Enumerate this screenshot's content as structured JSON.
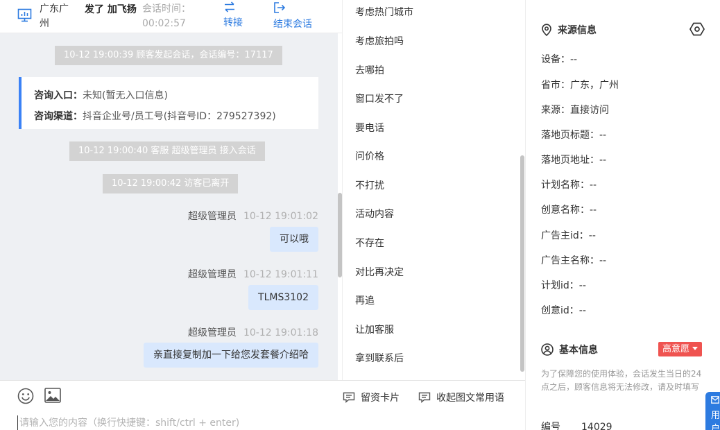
{
  "header": {
    "location": "广东广州",
    "visitor_name": "发了 加飞扬",
    "session_time_label": "会话时间：",
    "session_time_value": "00:02:57",
    "transfer_label": "转接",
    "end_label": "结束会话"
  },
  "chat": {
    "system_start": "10-12 19:00:39 顾客发起会话，会话编号：17117",
    "entry_label": "咨询入口：",
    "entry_value": "未知(暂无入口信息)",
    "channel_label": "咨询渠道：",
    "channel_value": "抖音企业号/员工号(抖音号ID：279527392)",
    "system_join": "10-12 19:00:40 客服 超级管理员 接入会话",
    "system_left": "10-12 19:00:42 访客已离开",
    "messages": [
      {
        "sender": "超级管理员",
        "time": "10-12 19:01:02",
        "text": "可以哦"
      },
      {
        "sender": "超级管理员",
        "time": "10-12 19:01:11",
        "text": "TLMS3102"
      },
      {
        "sender": "超级管理员",
        "time": "10-12 19:01:18",
        "text": "亲直接复制加一下给您发套餐介绍哈"
      }
    ]
  },
  "composer": {
    "card_label": "留资卡片",
    "collapse_label": "收起图文常用语",
    "placeholder": "请输入您的内容（换行快捷键：shift/ctrl + enter)"
  },
  "quick_replies": [
    "考虑热门城市",
    "考虑旅拍吗",
    "去哪拍",
    "窗口发不了",
    "要电话",
    "问价格",
    "不打扰",
    "活动内容",
    "不存在",
    "对比再决定",
    "再追",
    "让加客服",
    "拿到联系后"
  ],
  "source": {
    "title": "来源信息",
    "rows": [
      {
        "label": "设备：",
        "value": "--"
      },
      {
        "label": "省市：",
        "value": "广东，广州"
      },
      {
        "label": "来源：",
        "value": "直接访问"
      },
      {
        "label": "落地页标题：",
        "value": "--"
      },
      {
        "label": "落地页地址：",
        "value": "--"
      },
      {
        "label": "计划名称：",
        "value": "--"
      },
      {
        "label": "创意名称：",
        "value": "--"
      },
      {
        "label": "广告主id：",
        "value": "--"
      },
      {
        "label": "广告主名称：",
        "value": "--"
      },
      {
        "label": "计划id：",
        "value": "--"
      },
      {
        "label": "创意id：",
        "value": "--"
      }
    ]
  },
  "basic": {
    "title": "基本信息",
    "intent_badge": "高意愿",
    "notice": "为了保障您的使用体验，会话发生当日的24点之后，顾客信息将无法修改，请及时填写",
    "code_label": "编号",
    "code_value": "14029"
  },
  "float_tab": {
    "label": "用户"
  },
  "colors": {
    "accent": "#2d7be0",
    "bubble": "#d9e8fd",
    "chat_bg": "#eef0f3",
    "system_bg": "#d3d3d3",
    "badge": "#ef5350",
    "info_border": "#3b82f6"
  },
  "icons": [
    "monitor-icon",
    "transfer-icon",
    "exit-icon",
    "emoji-icon",
    "image-icon",
    "card-icon",
    "message-icon",
    "location-pin-icon",
    "settings-icon",
    "user-circle-icon",
    "caret-down-icon",
    "mail-icon"
  ]
}
